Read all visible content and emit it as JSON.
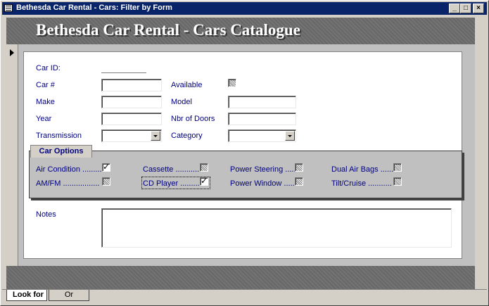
{
  "window": {
    "title": "Bethesda Car Rental - Cars: Filter by Form",
    "min_label": "_",
    "max_label": "□",
    "close_label": "×"
  },
  "header": {
    "title": "Bethesda Car Rental - Cars Catalogue"
  },
  "fields": {
    "car_id": {
      "label": "Car ID:"
    },
    "car_num": {
      "label": "Car #",
      "value": ""
    },
    "available": {
      "label": "Available",
      "state": "null"
    },
    "make": {
      "label": "Make",
      "value": ""
    },
    "model": {
      "label": "Model",
      "value": ""
    },
    "year": {
      "label": "Year",
      "value": ""
    },
    "doors": {
      "label": "Nbr of Doors",
      "value": ""
    },
    "transmission": {
      "label": "Transmission",
      "value": ""
    },
    "category": {
      "label": "Category",
      "value": ""
    }
  },
  "options": {
    "title": "Car Options",
    "items": [
      {
        "label": "Air Condition .........",
        "state": "checked"
      },
      {
        "label": "Cassette ...........",
        "state": "null"
      },
      {
        "label": "Power Steering .....",
        "state": "null"
      },
      {
        "label": "Dual Air Bags ......",
        "state": "null"
      },
      {
        "label": "AM/FM .................",
        "state": "null"
      },
      {
        "label": "CD Player .........",
        "state": "checked"
      },
      {
        "label": "Power Window .....",
        "state": "null"
      },
      {
        "label": "Tilt/Cruise ...........",
        "state": "null"
      }
    ]
  },
  "notes": {
    "label": "Notes",
    "value": ""
  },
  "tabs": [
    {
      "label": "Look for",
      "active": true
    },
    {
      "label": "Or",
      "active": false
    }
  ],
  "colors": {
    "label": "#00007f",
    "titlebar": "#0a246a",
    "band": "#6e6e6e"
  }
}
